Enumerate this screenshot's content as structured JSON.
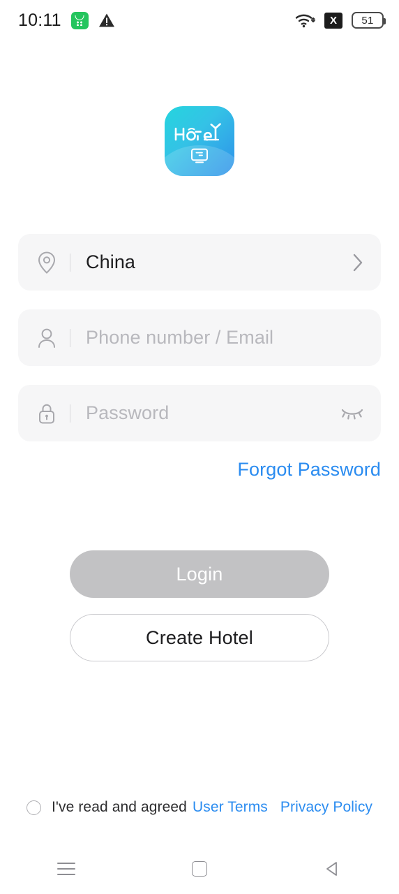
{
  "status_bar": {
    "time": "10:11",
    "left_icons": [
      {
        "name": "green-app-icon",
        "label": ""
      },
      {
        "name": "warning-triangle-icon",
        "label": ""
      }
    ],
    "right_icons": [
      {
        "name": "wifi-icon",
        "label": ""
      },
      {
        "name": "no-sim-icon",
        "label": "X"
      }
    ],
    "battery_level": "51"
  },
  "logo": {
    "wordmark": "Hotel",
    "alt": "Hotel app logo",
    "gradient_start": "#25d5de",
    "gradient_end": "#2e90ea"
  },
  "form": {
    "country": {
      "icon": "location-pin-icon",
      "value": "China",
      "chevron": "chevron-right-icon"
    },
    "account": {
      "icon": "user-icon",
      "placeholder": "Phone number / Email",
      "value": ""
    },
    "password": {
      "icon": "lock-icon",
      "placeholder": "Password",
      "value": "",
      "visibility_icon": "eye-closed-icon"
    },
    "forgot_password": "Forgot Password"
  },
  "actions": {
    "login": "Login",
    "login_enabled": false,
    "create_hotel": "Create Hotel"
  },
  "agreement": {
    "checked": false,
    "prefix": "I've read and agreed",
    "user_terms": "User Terms",
    "privacy_policy": "Privacy Policy",
    "link_color": "#2b8cf0"
  },
  "navbar": {
    "recents": "recents-icon",
    "home": "home-icon",
    "back": "back-icon"
  }
}
